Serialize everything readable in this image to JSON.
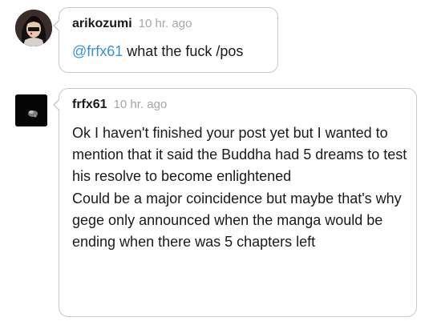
{
  "comments": [
    {
      "username": "arikozumi",
      "timestamp": "10 hr. ago",
      "mention": "@frfx61",
      "text": " what the fuck /pos"
    },
    {
      "username": "frfx61",
      "timestamp": "10 hr. ago",
      "paragraphs": [
        "Ok I haven't finished your post yet but I wanted to mention that it said the Buddha had 5 dreams to test his resolve to become enlightened",
        "Could be a major coincidence but maybe that's why gege only announced when the manga would be ending when there was 5 chapters left"
      ]
    }
  ],
  "colors": {
    "mention": "#3b8ed8",
    "timestamp": "#a7a7a7",
    "border": "#c9c9c9"
  }
}
